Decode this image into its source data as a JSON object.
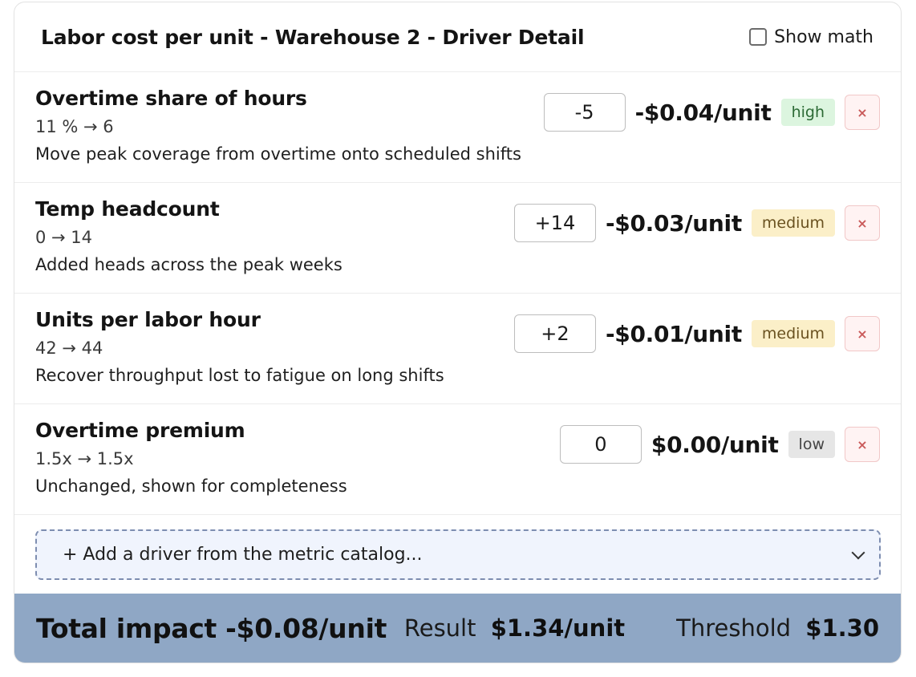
{
  "header": {
    "title": "Labor cost per unit - Warehouse 2 - Driver Detail",
    "show_math_label": "Show math",
    "show_math_checked": false
  },
  "drivers": [
    {
      "name": "Overtime share of hours",
      "range": "11 % → 6",
      "description": "Move peak coverage from overtime onto scheduled shifts",
      "adjustment": "-5",
      "impact": "-$0.04/unit",
      "confidence": "high",
      "remove_label": "×"
    },
    {
      "name": "Temp headcount",
      "range": "0 → 14",
      "description": "Added heads across the peak weeks",
      "adjustment": "+14",
      "impact": "-$0.03/unit",
      "confidence": "medium",
      "remove_label": "×"
    },
    {
      "name": "Units per labor hour",
      "range": "42 → 44",
      "description": "Recover throughput lost to fatigue on long shifts",
      "adjustment": "+2",
      "impact": "-$0.01/unit",
      "confidence": "medium",
      "remove_label": "×"
    },
    {
      "name": "Overtime premium",
      "range": "1.5x → 1.5x",
      "description": "Unchanged, shown for completeness",
      "adjustment": "0",
      "impact": "$0.00/unit",
      "confidence": "low",
      "remove_label": "×"
    }
  ],
  "add_driver": {
    "label": "+ Add a driver from the metric catalog..."
  },
  "footer": {
    "total": "Total impact -$0.08/unit",
    "result_label": "Result",
    "result_value": "$1.34/unit",
    "threshold_label": "Threshold",
    "threshold_value": "$1.30"
  },
  "colors": {
    "footer_bg": "#8fa7c5",
    "high": "#dcf5df",
    "medium": "#fbefc8",
    "low": "#e6e6e6"
  },
  "icons": {
    "remove": "close-icon",
    "dropdown": "chevron-down-icon"
  }
}
